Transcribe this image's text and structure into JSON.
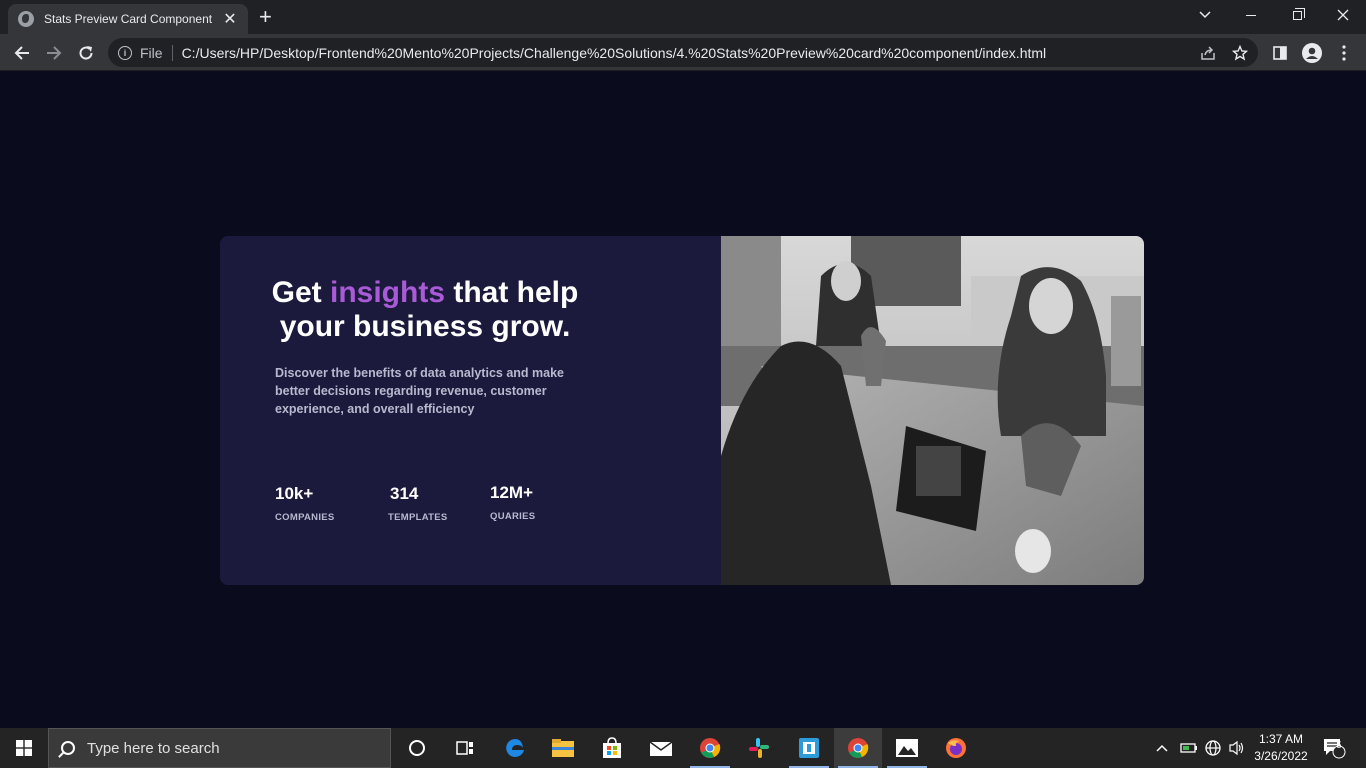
{
  "browser": {
    "tab_title": "Stats Preview Card Component",
    "close_tab_glyph": "✕",
    "new_tab_glyph": "+",
    "scheme_label": "File",
    "url": "C:/Users/HP/Desktop/Frontend%20Mento%20Projects/Challenge%20Solutions/4.%20Stats%20Preview%20card%20component/index.html"
  },
  "card": {
    "headline": {
      "before": "Get ",
      "accent": "insights",
      "after": " that help your business grow."
    },
    "description": "Discover the benefits of data analytics and make better decisions regarding revenue, customer experience, and overall efficiency",
    "stats": [
      {
        "value": "10k+",
        "label": "COMPANIES"
      },
      {
        "value": "314",
        "label": "TEMPLATES"
      },
      {
        "value": "12M+",
        "label": "QUARIES"
      }
    ],
    "accent_color": "#a95ad6",
    "card_background": "#1c1a3c",
    "page_background": "#0a0c1d"
  },
  "taskbar": {
    "search_placeholder": "Type here to search",
    "time": "1:37 AM",
    "date": "3/26/2022",
    "notification_count": "5",
    "apps": [
      "cortana-icon",
      "task-view-icon",
      "edge-icon",
      "file-explorer-icon",
      "store-icon",
      "mail-icon",
      "chrome-icon",
      "slack-icon",
      "app-icon",
      "chrome-icon",
      "photos-icon",
      "firefox-icon"
    ]
  }
}
